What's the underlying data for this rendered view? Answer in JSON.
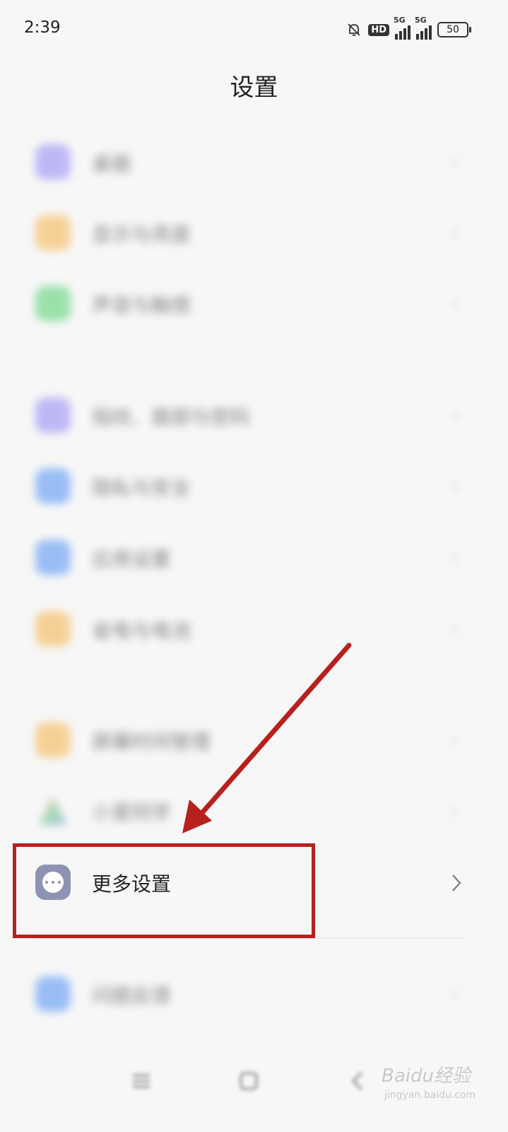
{
  "status_bar": {
    "time": "2:39",
    "hd": "HD",
    "net1": "5G",
    "net2": "5G",
    "battery": "50"
  },
  "page_title": "设置",
  "groups": [
    {
      "items": [
        {
          "label": "桌面",
          "icon": "desktop-icon",
          "color": "#8f86f5"
        },
        {
          "label": "显示与亮度",
          "icon": "display-icon",
          "color": "#f5b248"
        },
        {
          "label": "声音与触感",
          "icon": "sound-icon",
          "color": "#4fcf6b"
        }
      ]
    },
    {
      "items": [
        {
          "label": "指纹、面部与密码",
          "icon": "fingerprint-icon",
          "color": "#8f86f5"
        },
        {
          "label": "隐私与安全",
          "icon": "privacy-icon",
          "color": "#4d8ff5"
        },
        {
          "label": "应用设置",
          "icon": "apps-icon",
          "color": "#4d8ff5"
        },
        {
          "label": "省电与电池",
          "icon": "battery-saver-icon",
          "color": "#f5b248"
        }
      ]
    },
    {
      "items": [
        {
          "label": "屏幕时间管理",
          "icon": "screen-time-icon",
          "color": "#f5b248"
        },
        {
          "label": "小爱同学",
          "icon": "xiaoai-icon",
          "color": "#6cc07a"
        },
        {
          "label": "更多设置",
          "icon": "more-icon",
          "color": "#8e93b3"
        }
      ]
    },
    {
      "items": [
        {
          "label": "问题反馈",
          "icon": "feedback-icon",
          "color": "#4d8ff5"
        }
      ]
    }
  ],
  "chevron": "›",
  "watermark": {
    "text": "Baidu经验",
    "sub": "jingyan.baidu.com"
  },
  "annotation_color": "#b8201e"
}
